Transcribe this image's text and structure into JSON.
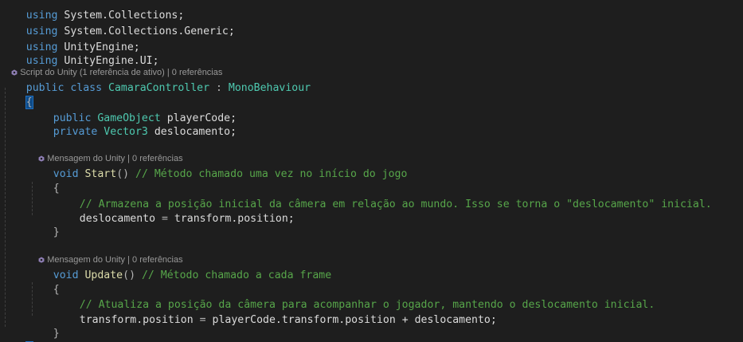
{
  "code": {
    "using_lines": [
      {
        "kw": "using",
        "ns": "System.Collections;"
      },
      {
        "kw": "using",
        "ns": "System.Collections.Generic;"
      },
      {
        "kw": "using",
        "ns": "UnityEngine;"
      },
      {
        "kw": "using",
        "ns": "UnityEngine.UI;"
      }
    ],
    "class_lens": "Script do Unity (1 referência de ativo) | 0 referências",
    "class_decl": {
      "kw1": "public",
      "kw2": "class",
      "name": "CamaraController",
      "colon": " : ",
      "base": "MonoBehaviour"
    },
    "open_brace": "{",
    "field1": {
      "kw": "public",
      "type": "GameObject",
      "name": "playerCode;"
    },
    "field2": {
      "kw": "private",
      "type": "Vector3",
      "name": "deslocamento;"
    },
    "start_lens": "Mensagem do Unity | 0 referências",
    "start_decl": {
      "kw": "void",
      "name": "Start",
      "parens": "()",
      "comment": "// Método chamado uma vez no início do jogo"
    },
    "start_open": "{",
    "start_comment": "// Armazena a posição inicial da câmera em relação ao mundo. Isso se torna o \"deslocamento\" inicial.",
    "start_body": {
      "lhs": "deslocamento",
      "op": " = ",
      "rhs": "transform.position;"
    },
    "start_close": "}",
    "update_lens": "Mensagem do Unity | 0 referências",
    "update_decl": {
      "kw": "void",
      "name": "Update",
      "parens": "()",
      "comment": "// Método chamado a cada frame"
    },
    "update_open": "{",
    "update_comment": "// Atualiza a posição da câmera para acompanhar o jogador, mantendo o deslocamento inicial.",
    "update_body": {
      "lhs": "transform.position",
      "op": " = ",
      "rhs": "playerCode.transform.position + deslocamento;"
    },
    "update_close": "}",
    "close_brace": "}"
  },
  "colors": {
    "background": "#1e1e1e",
    "keyword": "#569cd6",
    "type": "#4ec9b0",
    "method": "#dcdcaa",
    "identifier": "#dcdcdc",
    "comment": "#57a64a",
    "codelens": "#999999"
  },
  "icons": {
    "codelens": "unity-icon"
  }
}
